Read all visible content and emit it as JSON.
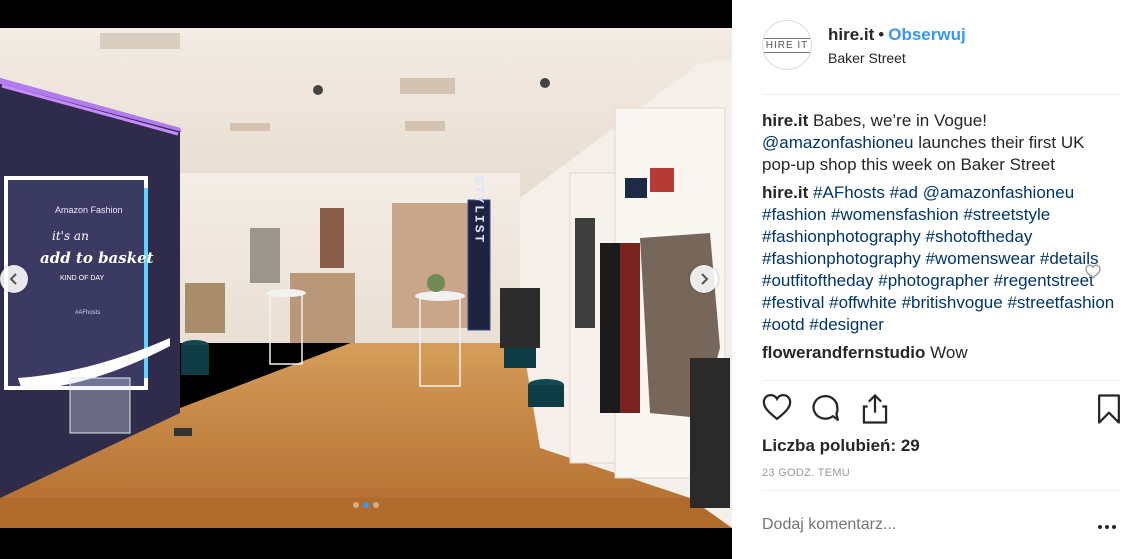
{
  "post": {
    "username": "hire.it",
    "separator": "•",
    "follow_label": "Obserwuj",
    "location": "Baker Street",
    "avatar_text": "HIRE IT"
  },
  "photo": {
    "brand_text": "Amazon Fashion",
    "neon_line1": "it's an",
    "neon_line2": "add to basket",
    "neon_line3": "KIND OF DAY",
    "neon_small": "#AFhosts",
    "sign_text": "STYLIST",
    "slides": 3,
    "active_slide": 2
  },
  "comments": [
    {
      "user": "hire.it",
      "parts": [
        {
          "text": " Babes, we’re in Vogue! ",
          "type": "text"
        },
        {
          "text": "@amazonfashioneu",
          "type": "link"
        },
        {
          "text": " launches their first UK pop-up shop this week on Baker Street",
          "type": "text"
        }
      ]
    },
    {
      "user": "hire.it",
      "parts": [
        {
          "text": " ",
          "type": "text"
        },
        {
          "text": "#AFhosts",
          "type": "link"
        },
        {
          "text": " ",
          "type": "text"
        },
        {
          "text": "#ad",
          "type": "link"
        },
        {
          "text": " ",
          "type": "text"
        },
        {
          "text": "@amazonfashioneu",
          "type": "link"
        },
        {
          "text": " ",
          "type": "text"
        },
        {
          "text": "#fashion",
          "type": "link"
        },
        {
          "text": " ",
          "type": "text"
        },
        {
          "text": "#womensfashion",
          "type": "link"
        },
        {
          "text": " ",
          "type": "text"
        },
        {
          "text": "#streetstyle",
          "type": "link"
        },
        {
          "text": " ",
          "type": "text"
        },
        {
          "text": "#fashionphotography",
          "type": "link"
        },
        {
          "text": " ",
          "type": "text"
        },
        {
          "text": "#shotoftheday",
          "type": "link"
        },
        {
          "text": " ",
          "type": "text"
        },
        {
          "text": "#fashionphotography",
          "type": "link"
        },
        {
          "text": " ",
          "type": "text"
        },
        {
          "text": "#womenswear",
          "type": "link"
        },
        {
          "text": " ",
          "type": "text"
        },
        {
          "text": "#details",
          "type": "link"
        },
        {
          "text": " ",
          "type": "text"
        },
        {
          "text": "#outfitoftheday",
          "type": "link"
        },
        {
          "text": " ",
          "type": "text"
        },
        {
          "text": "#photographer",
          "type": "link"
        },
        {
          "text": " ",
          "type": "text"
        },
        {
          "text": "#regentstreet",
          "type": "link"
        },
        {
          "text": " ",
          "type": "text"
        },
        {
          "text": "#festival",
          "type": "link"
        },
        {
          "text": " ",
          "type": "text"
        },
        {
          "text": "#offwhite",
          "type": "link"
        },
        {
          "text": " ",
          "type": "text"
        },
        {
          "text": "#britishvogue",
          "type": "link"
        },
        {
          "text": " ",
          "type": "text"
        },
        {
          "text": "#streetfashion",
          "type": "link"
        },
        {
          "text": " ",
          "type": "text"
        },
        {
          "text": "#ootd",
          "type": "link"
        },
        {
          "text": " ",
          "type": "text"
        },
        {
          "text": "#designer",
          "type": "link"
        }
      ]
    },
    {
      "user": "flowerandfernstudio",
      "parts": [
        {
          "text": " Wow",
          "type": "text"
        }
      ]
    }
  ],
  "likes_label": "Liczba polubień: 29",
  "time_ago": "23 GODZ. TEMU",
  "add_comment_placeholder": "Dodaj komentarz...",
  "more_label": "•••",
  "icons": {
    "like": "heart-icon",
    "comment": "comment-icon",
    "share": "share-icon",
    "save": "bookmark-icon",
    "comment_like": "heart-icon",
    "prev": "chevron-left-icon",
    "next": "chevron-right-icon"
  },
  "colors": {
    "follow": "#3897f0",
    "link": "#003569",
    "muted": "#999999",
    "text": "#262626",
    "active_dot": "#3897f0"
  }
}
